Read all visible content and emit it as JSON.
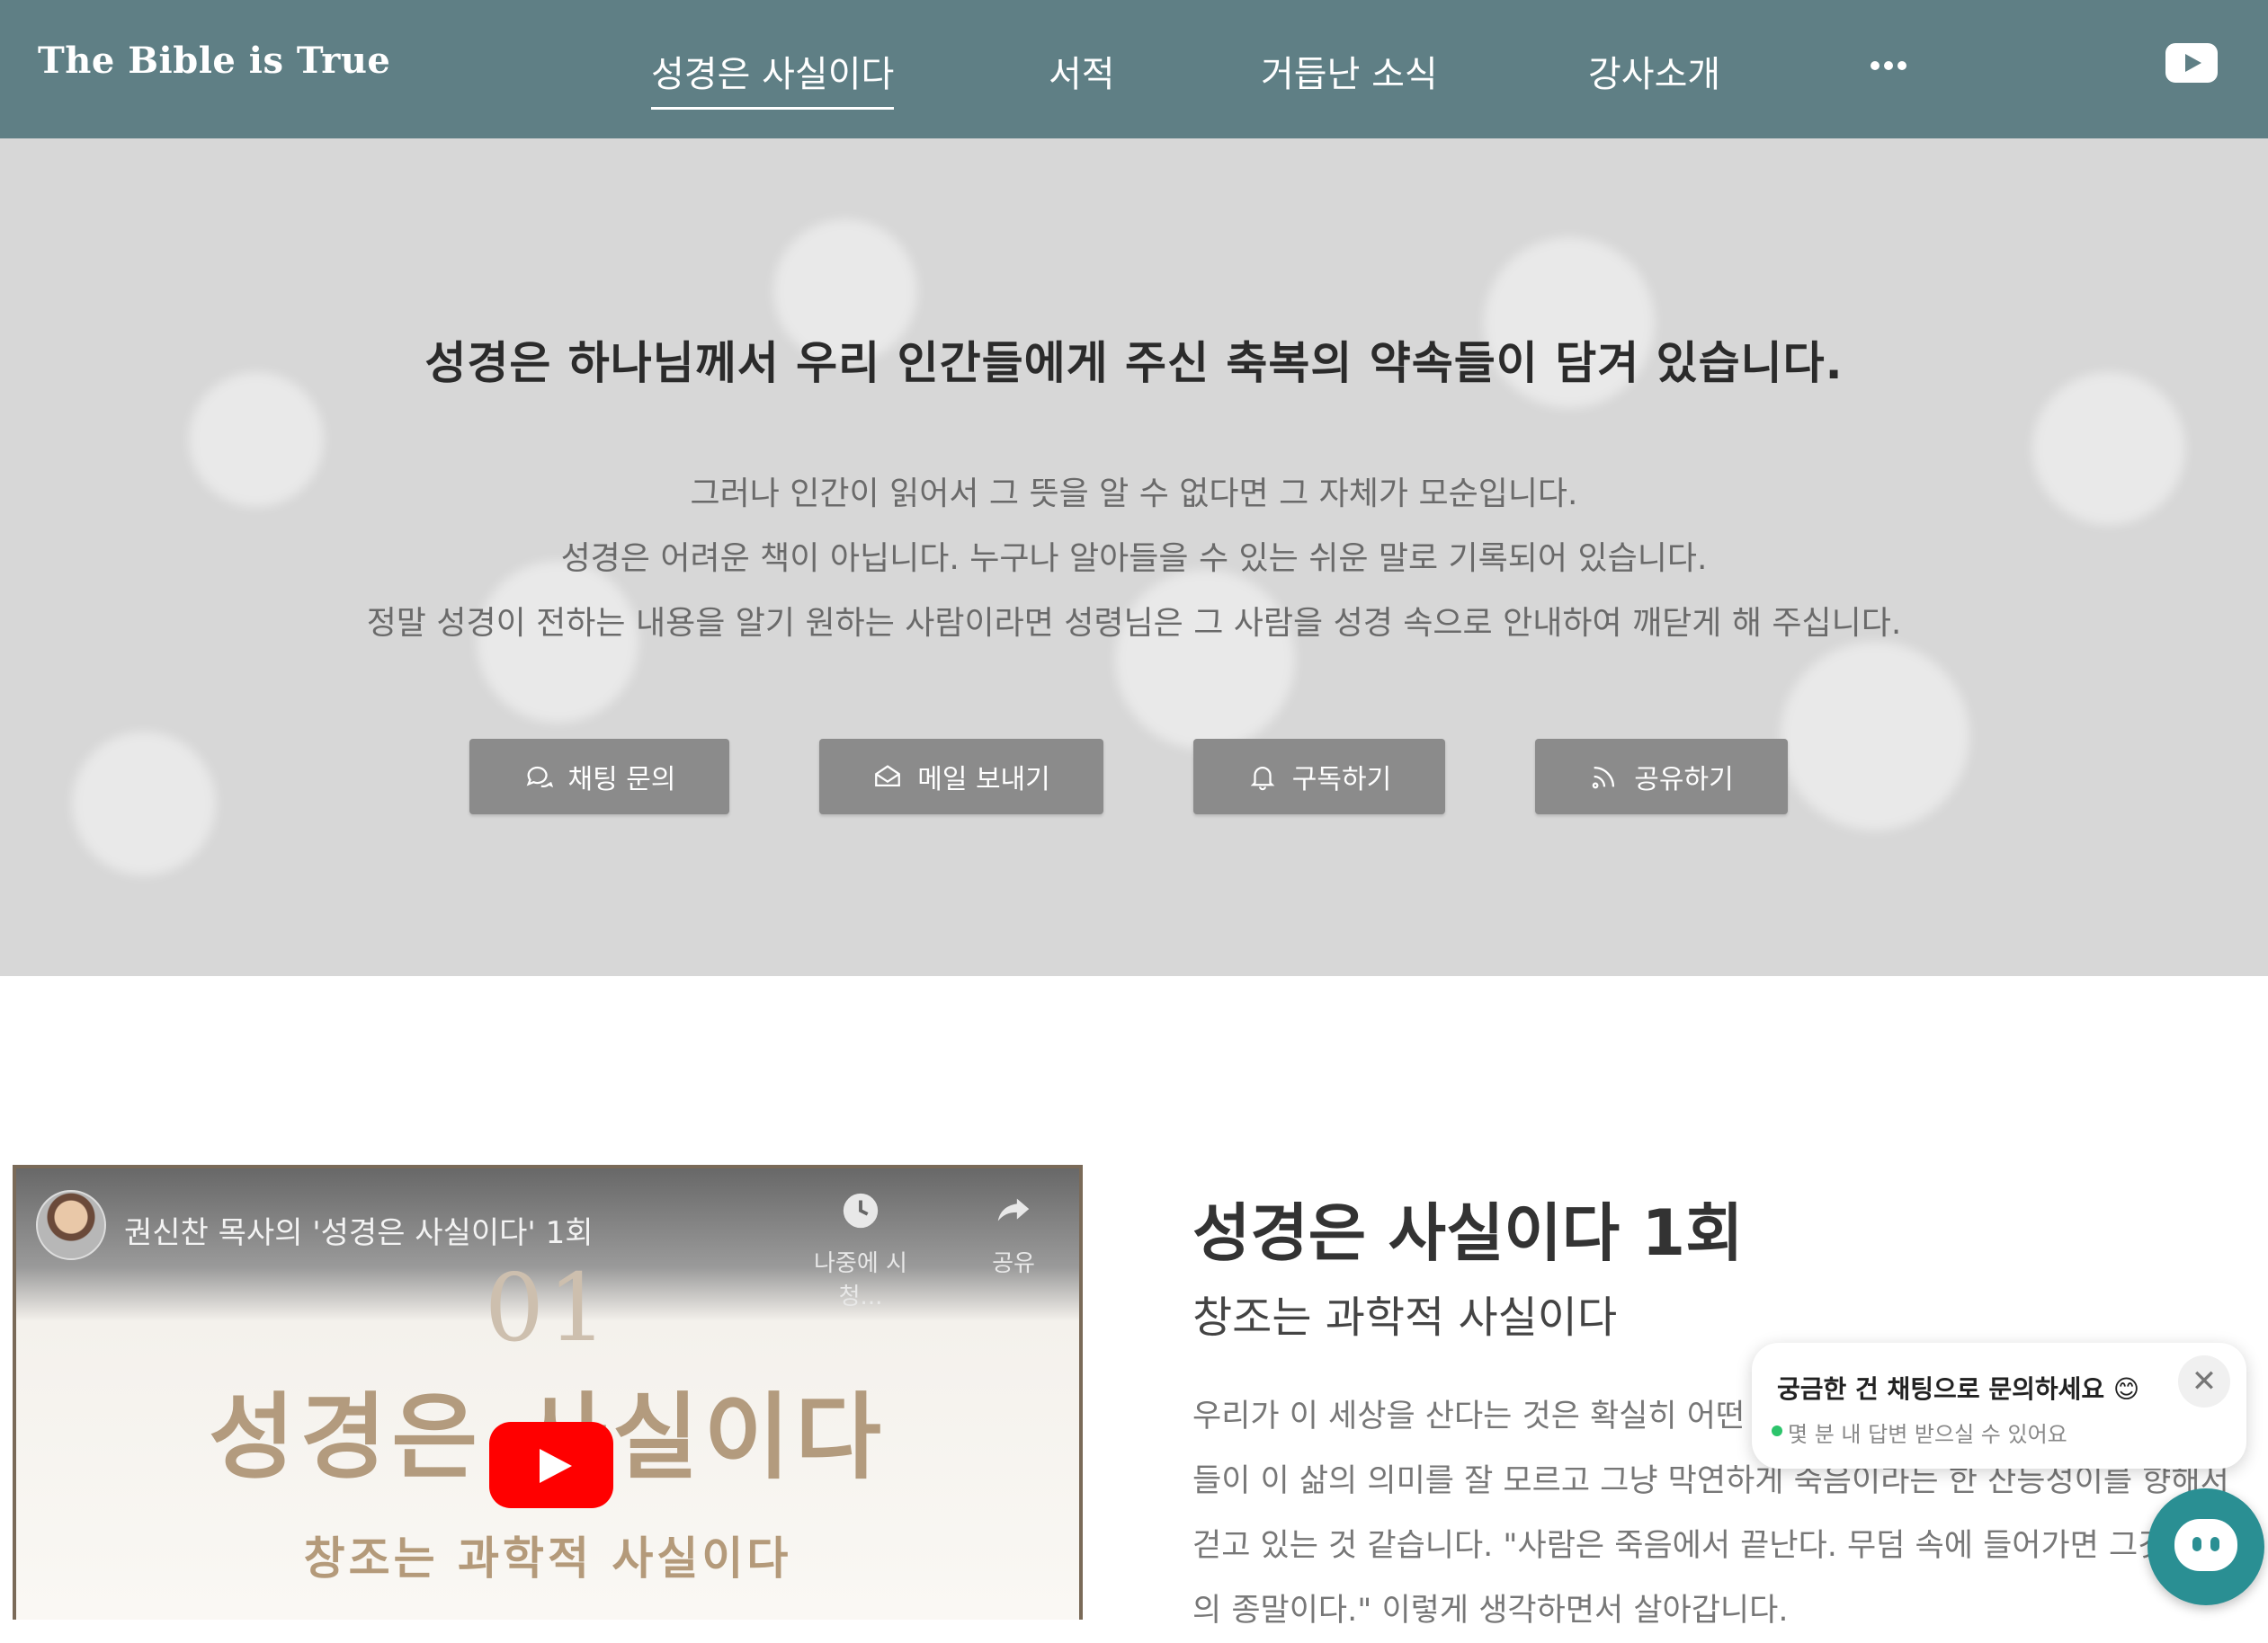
{
  "header": {
    "brand": "The Bible is True",
    "nav": [
      {
        "label": "성경은 사실이다",
        "active": true
      },
      {
        "label": "서적",
        "active": false
      },
      {
        "label": "거듭난 소식",
        "active": false
      },
      {
        "label": "강사소개",
        "active": false
      }
    ],
    "more_icon": "more-dots-icon",
    "youtube_icon": "youtube-icon",
    "background_color": "#5f7f85"
  },
  "hero": {
    "title": "성경은 하나님께서 우리 인간들에게 주신 축복의 약속들이 담겨 있습니다.",
    "lines": [
      "그러나 인간이 읽어서 그 뜻을 알 수 없다면 그 자체가 모순입니다.",
      "성경은 어려운 책이 아닙니다. 누구나 알아들을 수 있는 쉬운 말로 기록되어 있습니다.",
      "정말 성경이 전하는 내용을 알기 원하는 사람이라면 성령님은 그 사람을 성경 속으로 안내하여 깨닫게 해 주십니다."
    ],
    "buttons": [
      {
        "label": "채팅 문의",
        "icon": "chat-icon"
      },
      {
        "label": "메일 보내기",
        "icon": "mail-icon"
      },
      {
        "label": "구독하기",
        "icon": "bell-icon"
      },
      {
        "label": "공유하기",
        "icon": "rss-icon"
      }
    ]
  },
  "video": {
    "title": "권신찬 목사의 '성경은 사실이다' 1회",
    "watch_later": "나중에 시청...",
    "share": "공유",
    "number": "01",
    "big_title": "성경은 사실이다",
    "subtitle": "창조는 과학적 사실이다"
  },
  "episode": {
    "title": "성경은 사실이다 1회",
    "subtitle": "창조는 과학적 사실이다",
    "body": [
      "우리가 이 세상을 산다는 것은 확실히 어떤",
      "들이 이 삶의 의미를 잘 모르고 그냥 막연하게 죽음이라는 한 산등성이를 향해서",
      "걷고 있는 것 같습니다. \"사람은 죽음에서 끝난다. 무덤 속에 들어가면 그것",
      "의 종말이다.\" 이렇게 생각하면서 살아갑니다."
    ]
  },
  "chat": {
    "prompt": "궁금한 건 채팅으로 문의하세요 😊",
    "status": "몇 분 내 답변 받으실 수 있어요",
    "close": "✕",
    "accent": "#2a8f93"
  }
}
